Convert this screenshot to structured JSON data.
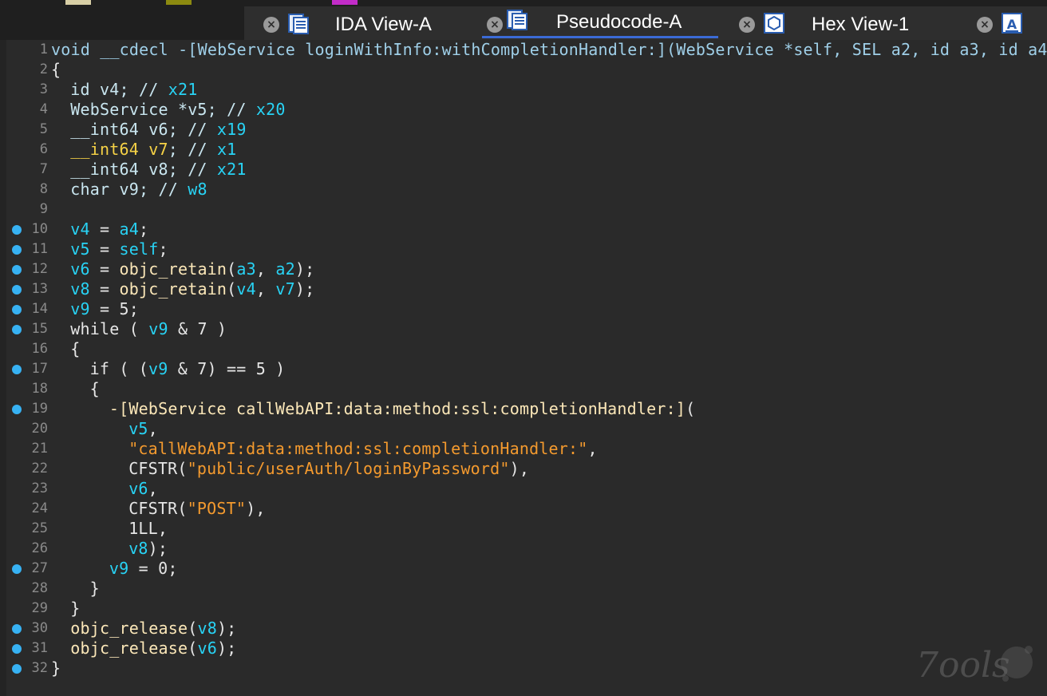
{
  "tabs": [
    {
      "label": "IDA View-A",
      "active": false,
      "icon": "disassembly-view-icon"
    },
    {
      "label": "Pseudocode-A",
      "active": true,
      "icon": "pseudocode-view-icon"
    },
    {
      "label": "Hex View-1",
      "active": false,
      "icon": "hex-view-icon"
    },
    {
      "label": "",
      "active": false,
      "icon": "structures-view-icon"
    }
  ],
  "top_legend": [
    {
      "color": "#d8cfa6"
    },
    {
      "color": "#8c8a10"
    },
    {
      "color": "#c22cc8"
    }
  ],
  "colors": {
    "accent_tab_underline": "#3b6bd6",
    "breakpoint": "#37b2f3",
    "variable": "#28d3f5",
    "string": "#f49a2e",
    "highlight": "#f6d246",
    "function": "#fbe7b8"
  },
  "watermark": {
    "text": "7ools"
  },
  "code": {
    "lines": [
      {
        "n": "1",
        "bp": false,
        "indent": 0,
        "parts": [
          [
            "void __cdecl -[WebService loginWithInfo:withCompletionHandler:](WebService *self, SEL a2, id a3, id a4)",
            "sig"
          ]
        ]
      },
      {
        "n": "2",
        "bp": false,
        "indent": 0,
        "parts": [
          [
            "{",
            "def"
          ]
        ]
      },
      {
        "n": "3",
        "bp": false,
        "indent": 1,
        "parts": [
          [
            "id v4; // ",
            "type"
          ],
          [
            "x21",
            "reg"
          ]
        ]
      },
      {
        "n": "4",
        "bp": false,
        "indent": 1,
        "parts": [
          [
            "WebService *v5; // ",
            "type"
          ],
          [
            "x20",
            "reg"
          ]
        ]
      },
      {
        "n": "5",
        "bp": false,
        "indent": 1,
        "parts": [
          [
            "__int64 v6; // ",
            "type"
          ],
          [
            "x19",
            "reg"
          ]
        ]
      },
      {
        "n": "6",
        "bp": false,
        "indent": 1,
        "parts": [
          [
            "__int64 v7",
            "hl"
          ],
          [
            "; // ",
            "type"
          ],
          [
            "x1",
            "reg"
          ]
        ]
      },
      {
        "n": "7",
        "bp": false,
        "indent": 1,
        "parts": [
          [
            "__int64 v8; // ",
            "type"
          ],
          [
            "x21",
            "reg"
          ]
        ]
      },
      {
        "n": "8",
        "bp": false,
        "indent": 1,
        "parts": [
          [
            "char v9; // ",
            "type"
          ],
          [
            "w8",
            "reg"
          ]
        ]
      },
      {
        "n": "9",
        "bp": false,
        "indent": 0,
        "parts": []
      },
      {
        "n": "10",
        "bp": true,
        "indent": 1,
        "parts": [
          [
            "v4",
            "var"
          ],
          [
            " = ",
            "def"
          ],
          [
            "a4",
            "var"
          ],
          [
            ";",
            "def"
          ]
        ]
      },
      {
        "n": "11",
        "bp": true,
        "indent": 1,
        "parts": [
          [
            "v5",
            "var"
          ],
          [
            " = ",
            "def"
          ],
          [
            "self",
            "var"
          ],
          [
            ";",
            "def"
          ]
        ]
      },
      {
        "n": "12",
        "bp": true,
        "indent": 1,
        "parts": [
          [
            "v6",
            "var"
          ],
          [
            " = ",
            "def"
          ],
          [
            "objc_retain",
            "call"
          ],
          [
            "(",
            "def"
          ],
          [
            "a3",
            "var"
          ],
          [
            ", ",
            "def"
          ],
          [
            "a2",
            "var"
          ],
          [
            ");",
            "def"
          ]
        ]
      },
      {
        "n": "13",
        "bp": true,
        "indent": 1,
        "parts": [
          [
            "v8",
            "var"
          ],
          [
            " = ",
            "def"
          ],
          [
            "objc_retain",
            "call"
          ],
          [
            "(",
            "def"
          ],
          [
            "v4",
            "var"
          ],
          [
            ", ",
            "def"
          ],
          [
            "v7",
            "var"
          ],
          [
            ");",
            "def"
          ]
        ]
      },
      {
        "n": "14",
        "bp": true,
        "indent": 1,
        "parts": [
          [
            "v9",
            "var"
          ],
          [
            " = 5;",
            "def"
          ]
        ]
      },
      {
        "n": "15",
        "bp": true,
        "indent": 1,
        "parts": [
          [
            "while ( ",
            "def"
          ],
          [
            "v9",
            "var"
          ],
          [
            " & 7 )",
            "def"
          ]
        ]
      },
      {
        "n": "16",
        "bp": false,
        "indent": 1,
        "parts": [
          [
            "{",
            "def"
          ]
        ]
      },
      {
        "n": "17",
        "bp": true,
        "indent": 2,
        "parts": [
          [
            "if ( (",
            "def"
          ],
          [
            "v9",
            "var"
          ],
          [
            " & 7) == 5 )",
            "def"
          ]
        ]
      },
      {
        "n": "18",
        "bp": false,
        "indent": 2,
        "parts": [
          [
            "{",
            "def"
          ]
        ]
      },
      {
        "n": "19",
        "bp": true,
        "indent": 3,
        "parts": [
          [
            "-[WebService callWebAPI:data:method:ssl:completionHandler:]",
            "fn"
          ],
          [
            "(",
            "def"
          ]
        ]
      },
      {
        "n": "20",
        "bp": false,
        "indent": 4,
        "parts": [
          [
            "v5",
            "var"
          ],
          [
            ",",
            "def"
          ]
        ]
      },
      {
        "n": "21",
        "bp": false,
        "indent": 4,
        "parts": [
          [
            "\"callWebAPI:data:method:ssl:completionHandler:\"",
            "str"
          ],
          [
            ",",
            "def"
          ]
        ]
      },
      {
        "n": "22",
        "bp": false,
        "indent": 4,
        "parts": [
          [
            "CFSTR(",
            "def"
          ],
          [
            "\"public/userAuth/loginByPassword\"",
            "str"
          ],
          [
            "),",
            "def"
          ]
        ]
      },
      {
        "n": "23",
        "bp": false,
        "indent": 4,
        "parts": [
          [
            "v6",
            "var"
          ],
          [
            ",",
            "def"
          ]
        ]
      },
      {
        "n": "24",
        "bp": false,
        "indent": 4,
        "parts": [
          [
            "CFSTR(",
            "def"
          ],
          [
            "\"POST\"",
            "str"
          ],
          [
            "),",
            "def"
          ]
        ]
      },
      {
        "n": "25",
        "bp": false,
        "indent": 4,
        "parts": [
          [
            "1LL,",
            "def"
          ]
        ]
      },
      {
        "n": "26",
        "bp": false,
        "indent": 4,
        "parts": [
          [
            "v8",
            "var"
          ],
          [
            ");",
            "def"
          ]
        ]
      },
      {
        "n": "27",
        "bp": true,
        "indent": 3,
        "parts": [
          [
            "v9",
            "var"
          ],
          [
            " = 0;",
            "def"
          ]
        ]
      },
      {
        "n": "28",
        "bp": false,
        "indent": 2,
        "parts": [
          [
            "}",
            "def"
          ]
        ]
      },
      {
        "n": "29",
        "bp": false,
        "indent": 1,
        "parts": [
          [
            "}",
            "def"
          ]
        ]
      },
      {
        "n": "30",
        "bp": true,
        "indent": 1,
        "parts": [
          [
            "objc_release",
            "call"
          ],
          [
            "(",
            "def"
          ],
          [
            "v8",
            "var"
          ],
          [
            ");",
            "def"
          ]
        ]
      },
      {
        "n": "31",
        "bp": true,
        "indent": 1,
        "parts": [
          [
            "objc_release",
            "call"
          ],
          [
            "(",
            "def"
          ],
          [
            "v6",
            "var"
          ],
          [
            ");",
            "def"
          ]
        ]
      },
      {
        "n": "32",
        "bp": true,
        "indent": 0,
        "parts": [
          [
            "}",
            "def"
          ]
        ]
      }
    ]
  }
}
